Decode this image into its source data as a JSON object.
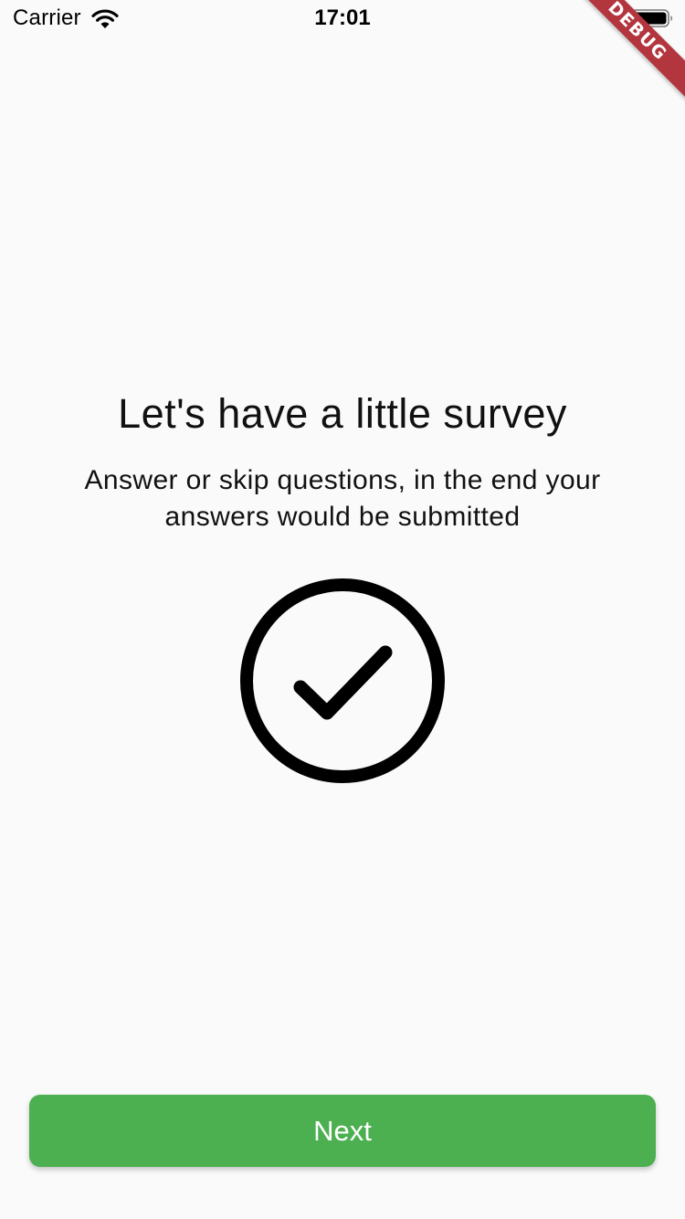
{
  "status_bar": {
    "carrier": "Carrier",
    "time": "17:01",
    "wifi_icon": "wifi-icon",
    "battery_icon": "battery-icon"
  },
  "debug_banner": {
    "label": "DEBUG",
    "color": "#b3363f"
  },
  "intro": {
    "title": "Let's have a little survey",
    "description": "Answer or skip questions, in the end your answers would be submitted",
    "icon": "check-circle-icon"
  },
  "actions": {
    "next_label": "Next",
    "accent_color": "#4caf50"
  },
  "colors": {
    "background": "#fafafa",
    "text": "#111111"
  }
}
